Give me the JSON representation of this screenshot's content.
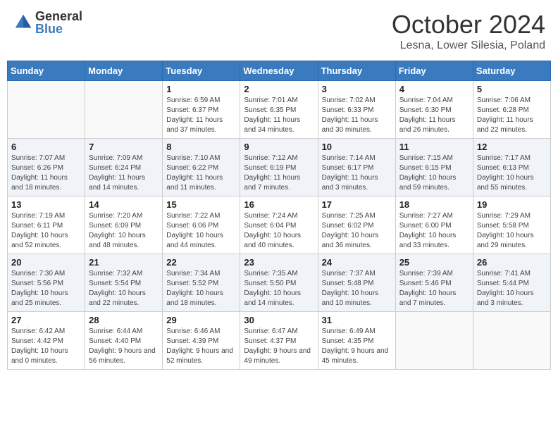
{
  "header": {
    "logo_general": "General",
    "logo_blue": "Blue",
    "month_title": "October 2024",
    "location": "Lesna, Lower Silesia, Poland"
  },
  "days_of_week": [
    "Sunday",
    "Monday",
    "Tuesday",
    "Wednesday",
    "Thursday",
    "Friday",
    "Saturday"
  ],
  "weeks": [
    [
      {
        "day": "",
        "sunrise": "",
        "sunset": "",
        "daylight": ""
      },
      {
        "day": "",
        "sunrise": "",
        "sunset": "",
        "daylight": ""
      },
      {
        "day": "1",
        "sunrise": "Sunrise: 6:59 AM",
        "sunset": "Sunset: 6:37 PM",
        "daylight": "Daylight: 11 hours and 37 minutes."
      },
      {
        "day": "2",
        "sunrise": "Sunrise: 7:01 AM",
        "sunset": "Sunset: 6:35 PM",
        "daylight": "Daylight: 11 hours and 34 minutes."
      },
      {
        "day": "3",
        "sunrise": "Sunrise: 7:02 AM",
        "sunset": "Sunset: 6:33 PM",
        "daylight": "Daylight: 11 hours and 30 minutes."
      },
      {
        "day": "4",
        "sunrise": "Sunrise: 7:04 AM",
        "sunset": "Sunset: 6:30 PM",
        "daylight": "Daylight: 11 hours and 26 minutes."
      },
      {
        "day": "5",
        "sunrise": "Sunrise: 7:06 AM",
        "sunset": "Sunset: 6:28 PM",
        "daylight": "Daylight: 11 hours and 22 minutes."
      }
    ],
    [
      {
        "day": "6",
        "sunrise": "Sunrise: 7:07 AM",
        "sunset": "Sunset: 6:26 PM",
        "daylight": "Daylight: 11 hours and 18 minutes."
      },
      {
        "day": "7",
        "sunrise": "Sunrise: 7:09 AM",
        "sunset": "Sunset: 6:24 PM",
        "daylight": "Daylight: 11 hours and 14 minutes."
      },
      {
        "day": "8",
        "sunrise": "Sunrise: 7:10 AM",
        "sunset": "Sunset: 6:22 PM",
        "daylight": "Daylight: 11 hours and 11 minutes."
      },
      {
        "day": "9",
        "sunrise": "Sunrise: 7:12 AM",
        "sunset": "Sunset: 6:19 PM",
        "daylight": "Daylight: 11 hours and 7 minutes."
      },
      {
        "day": "10",
        "sunrise": "Sunrise: 7:14 AM",
        "sunset": "Sunset: 6:17 PM",
        "daylight": "Daylight: 11 hours and 3 minutes."
      },
      {
        "day": "11",
        "sunrise": "Sunrise: 7:15 AM",
        "sunset": "Sunset: 6:15 PM",
        "daylight": "Daylight: 10 hours and 59 minutes."
      },
      {
        "day": "12",
        "sunrise": "Sunrise: 7:17 AM",
        "sunset": "Sunset: 6:13 PM",
        "daylight": "Daylight: 10 hours and 55 minutes."
      }
    ],
    [
      {
        "day": "13",
        "sunrise": "Sunrise: 7:19 AM",
        "sunset": "Sunset: 6:11 PM",
        "daylight": "Daylight: 10 hours and 52 minutes."
      },
      {
        "day": "14",
        "sunrise": "Sunrise: 7:20 AM",
        "sunset": "Sunset: 6:09 PM",
        "daylight": "Daylight: 10 hours and 48 minutes."
      },
      {
        "day": "15",
        "sunrise": "Sunrise: 7:22 AM",
        "sunset": "Sunset: 6:06 PM",
        "daylight": "Daylight: 10 hours and 44 minutes."
      },
      {
        "day": "16",
        "sunrise": "Sunrise: 7:24 AM",
        "sunset": "Sunset: 6:04 PM",
        "daylight": "Daylight: 10 hours and 40 minutes."
      },
      {
        "day": "17",
        "sunrise": "Sunrise: 7:25 AM",
        "sunset": "Sunset: 6:02 PM",
        "daylight": "Daylight: 10 hours and 36 minutes."
      },
      {
        "day": "18",
        "sunrise": "Sunrise: 7:27 AM",
        "sunset": "Sunset: 6:00 PM",
        "daylight": "Daylight: 10 hours and 33 minutes."
      },
      {
        "day": "19",
        "sunrise": "Sunrise: 7:29 AM",
        "sunset": "Sunset: 5:58 PM",
        "daylight": "Daylight: 10 hours and 29 minutes."
      }
    ],
    [
      {
        "day": "20",
        "sunrise": "Sunrise: 7:30 AM",
        "sunset": "Sunset: 5:56 PM",
        "daylight": "Daylight: 10 hours and 25 minutes."
      },
      {
        "day": "21",
        "sunrise": "Sunrise: 7:32 AM",
        "sunset": "Sunset: 5:54 PM",
        "daylight": "Daylight: 10 hours and 22 minutes."
      },
      {
        "day": "22",
        "sunrise": "Sunrise: 7:34 AM",
        "sunset": "Sunset: 5:52 PM",
        "daylight": "Daylight: 10 hours and 18 minutes."
      },
      {
        "day": "23",
        "sunrise": "Sunrise: 7:35 AM",
        "sunset": "Sunset: 5:50 PM",
        "daylight": "Daylight: 10 hours and 14 minutes."
      },
      {
        "day": "24",
        "sunrise": "Sunrise: 7:37 AM",
        "sunset": "Sunset: 5:48 PM",
        "daylight": "Daylight: 10 hours and 10 minutes."
      },
      {
        "day": "25",
        "sunrise": "Sunrise: 7:39 AM",
        "sunset": "Sunset: 5:46 PM",
        "daylight": "Daylight: 10 hours and 7 minutes."
      },
      {
        "day": "26",
        "sunrise": "Sunrise: 7:41 AM",
        "sunset": "Sunset: 5:44 PM",
        "daylight": "Daylight: 10 hours and 3 minutes."
      }
    ],
    [
      {
        "day": "27",
        "sunrise": "Sunrise: 6:42 AM",
        "sunset": "Sunset: 4:42 PM",
        "daylight": "Daylight: 10 hours and 0 minutes."
      },
      {
        "day": "28",
        "sunrise": "Sunrise: 6:44 AM",
        "sunset": "Sunset: 4:40 PM",
        "daylight": "Daylight: 9 hours and 56 minutes."
      },
      {
        "day": "29",
        "sunrise": "Sunrise: 6:46 AM",
        "sunset": "Sunset: 4:39 PM",
        "daylight": "Daylight: 9 hours and 52 minutes."
      },
      {
        "day": "30",
        "sunrise": "Sunrise: 6:47 AM",
        "sunset": "Sunset: 4:37 PM",
        "daylight": "Daylight: 9 hours and 49 minutes."
      },
      {
        "day": "31",
        "sunrise": "Sunrise: 6:49 AM",
        "sunset": "Sunset: 4:35 PM",
        "daylight": "Daylight: 9 hours and 45 minutes."
      },
      {
        "day": "",
        "sunrise": "",
        "sunset": "",
        "daylight": ""
      },
      {
        "day": "",
        "sunrise": "",
        "sunset": "",
        "daylight": ""
      }
    ]
  ]
}
